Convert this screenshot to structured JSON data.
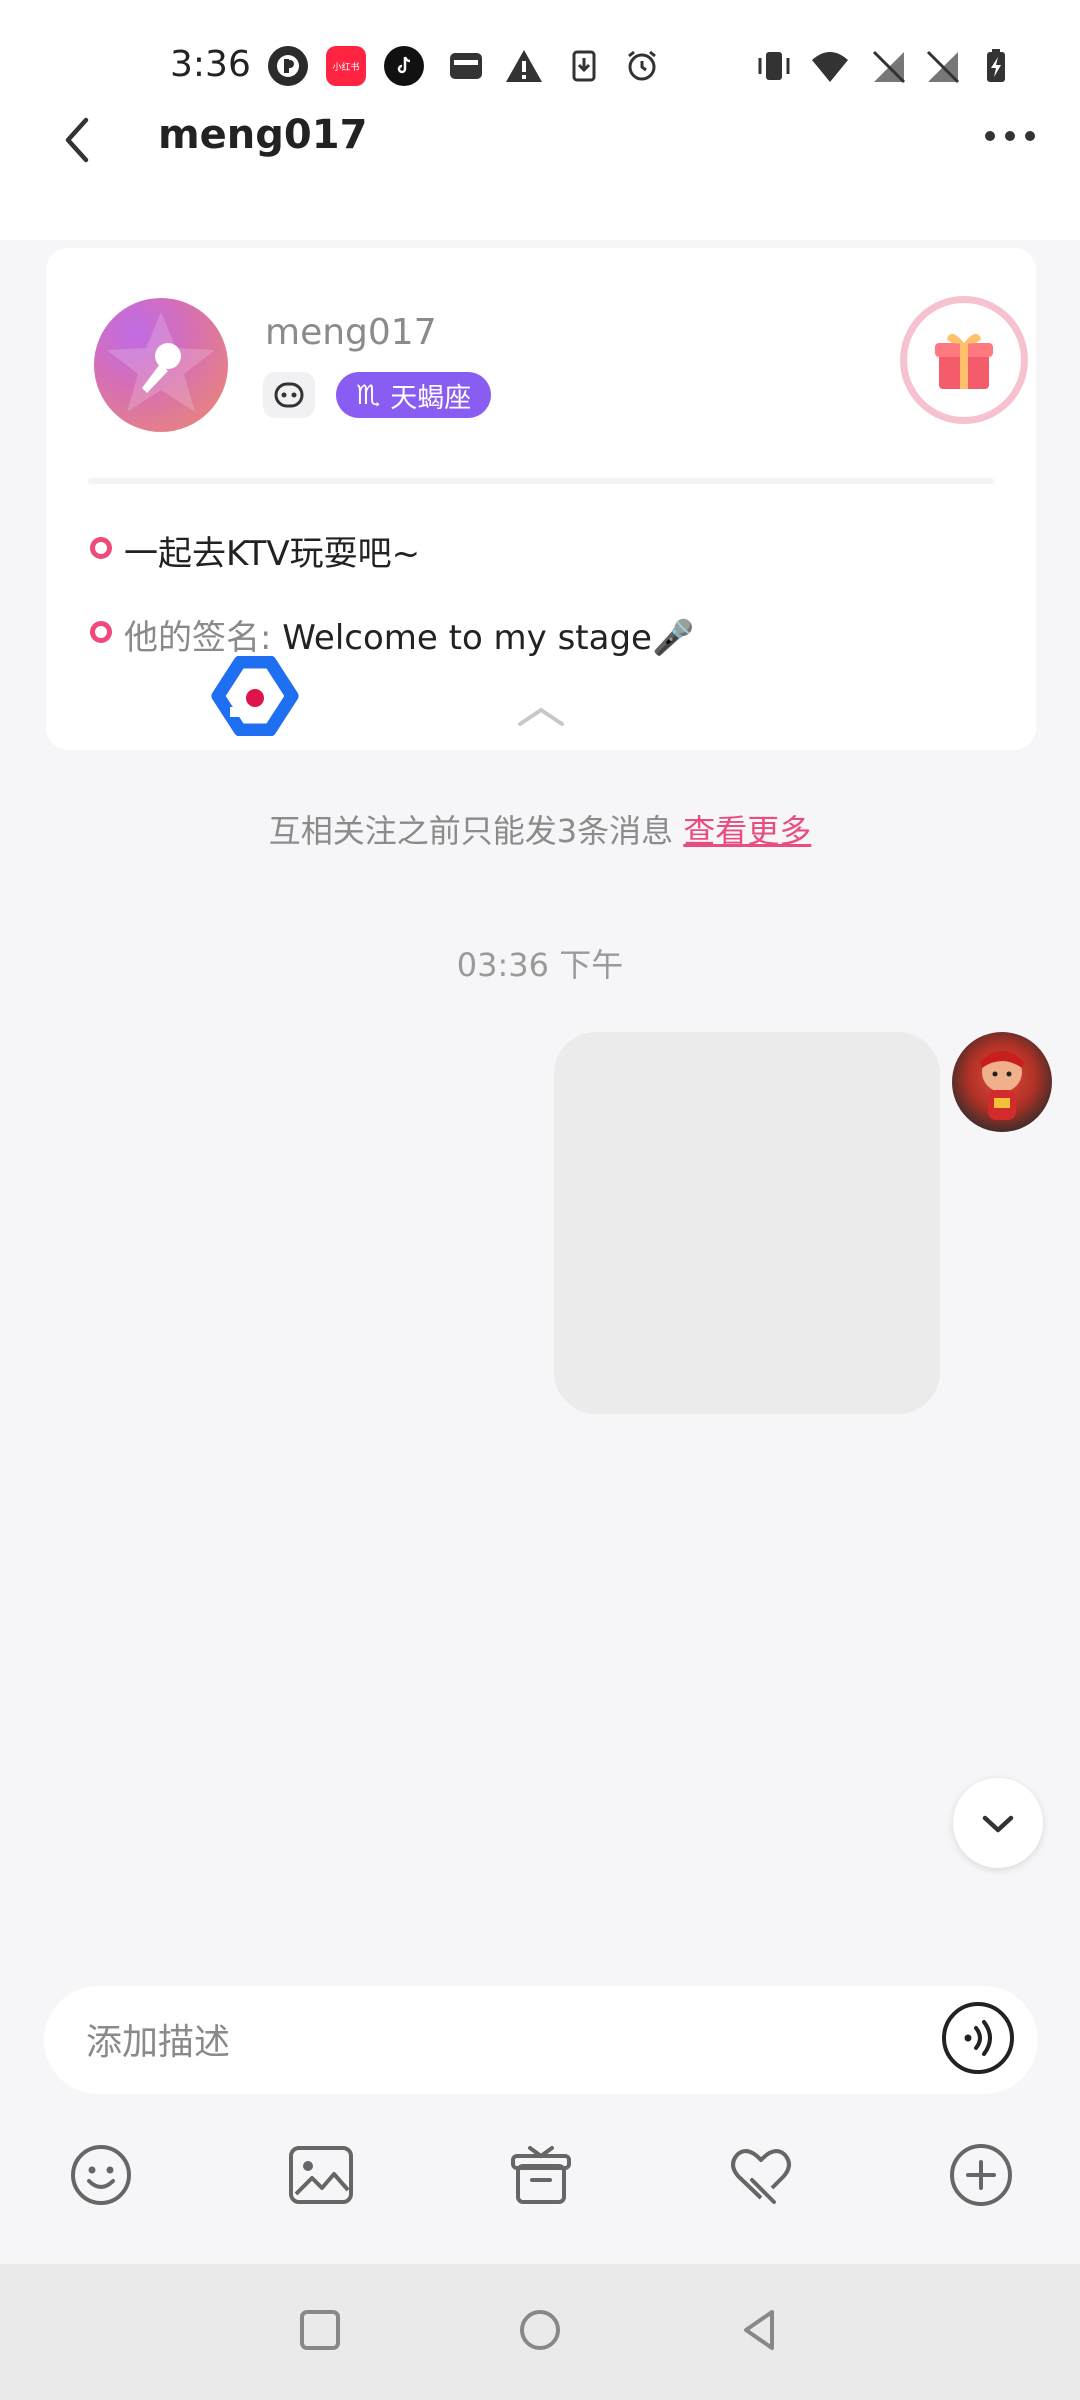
{
  "status_bar": {
    "time": "3:36",
    "xhs_label": "小红书"
  },
  "header": {
    "title": "meng017"
  },
  "profile": {
    "name": "meng017",
    "zodiac_symbol": "♏",
    "zodiac": "天蝎座",
    "line1": "一起去KTV玩耍吧~",
    "sign_label": "他的签名:",
    "sign_text": " Welcome to my stage🎤"
  },
  "chat": {
    "notice_text": "互相关注之前只能发3条消息 ",
    "notice_link": "查看更多",
    "timestamp": "03:36 下午"
  },
  "input": {
    "placeholder": "添加描述"
  },
  "icons": {
    "toolbar": [
      "emoji-icon",
      "image-icon",
      "gift-box-icon",
      "heart-hand-icon",
      "plus-icon"
    ],
    "nav": [
      "recents-square-icon",
      "home-circle-icon",
      "back-triangle-icon"
    ]
  },
  "colors": {
    "accent_pink": "#e94d7f",
    "zodiac_purple": "#8a5df2",
    "background": "#f6f6f8"
  }
}
